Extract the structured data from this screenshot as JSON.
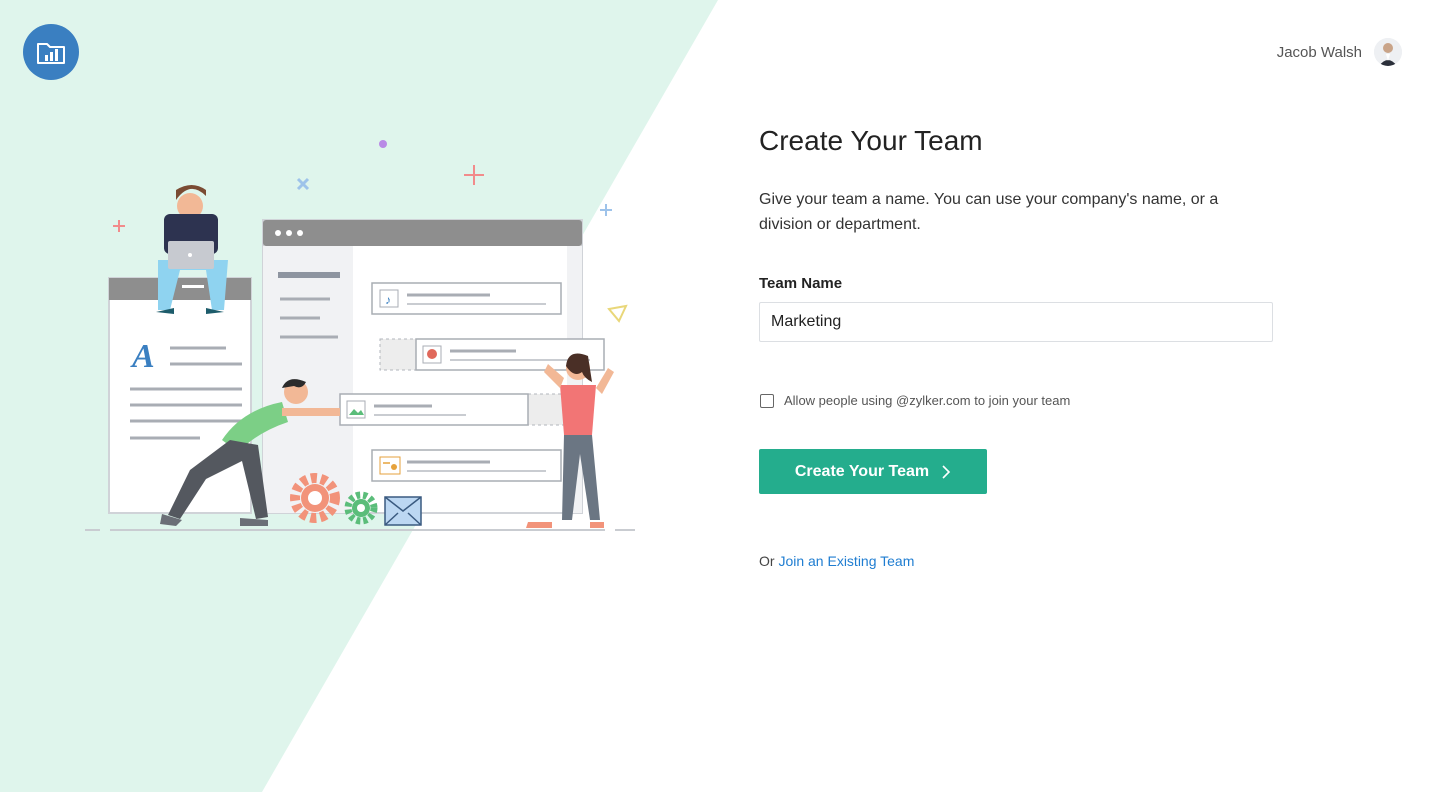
{
  "header": {
    "user_name": "Jacob Walsh",
    "logo_icon": "folder-chart-icon",
    "avatar_icon": "user-avatar"
  },
  "form": {
    "title": "Create Your Team",
    "description": "Give your team a name. You can use your company's name, or a division or department.",
    "team_name_label": "Team Name",
    "team_name_value": "Marketing",
    "allow_checkbox_label": "Allow people using @zylker.com to join your team",
    "allow_checkbox_checked": false,
    "create_button_label": "Create Your Team",
    "join_prefix": "Or",
    "join_link_label": "Join an Existing Team"
  },
  "colors": {
    "background_mint": "#dff5ec",
    "logo_blue": "#3a7fc1",
    "button_green": "#24ad8d",
    "link_blue": "#1f7dd1"
  }
}
